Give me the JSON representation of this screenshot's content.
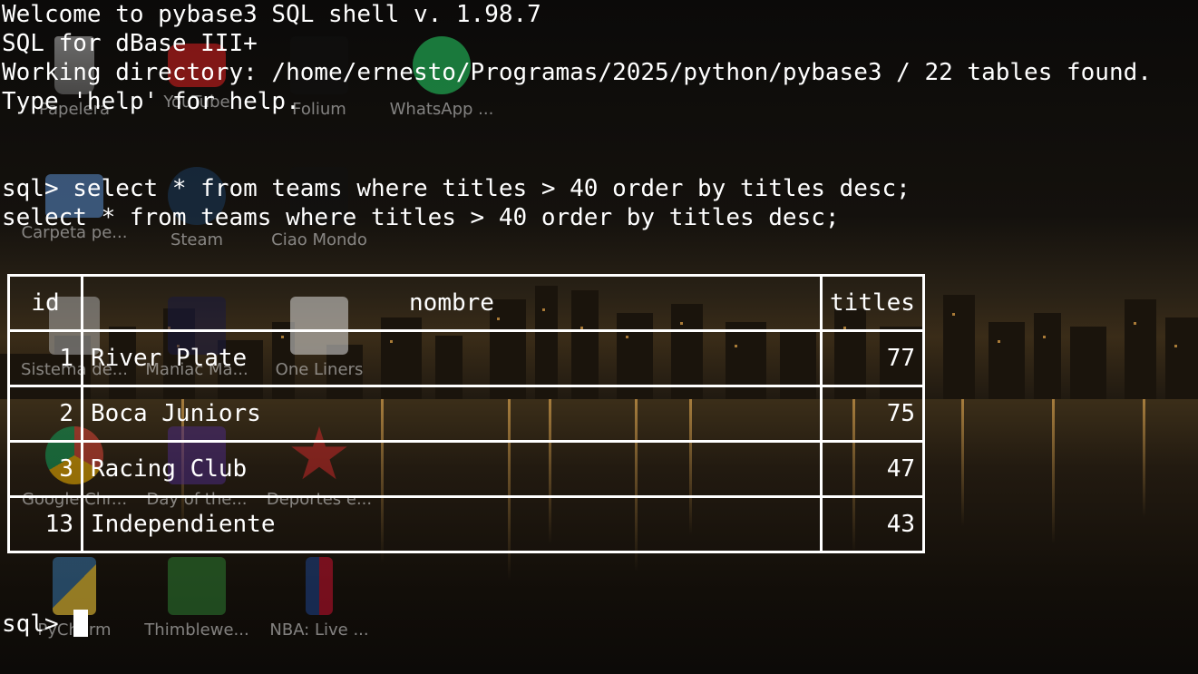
{
  "desktop": {
    "icons": [
      {
        "label": "Papelera",
        "icon": "trash-icon"
      },
      {
        "label": "YouTube",
        "icon": "youtube-icon"
      },
      {
        "label": "Folium",
        "icon": "folium-icon"
      },
      {
        "label": "WhatsApp ...",
        "icon": "whatsapp-icon"
      },
      {
        "label": "Carpeta pe...",
        "icon": "folder-icon"
      },
      {
        "label": "Steam",
        "icon": "steam-icon"
      },
      {
        "label": "Ciao Mondo",
        "icon": "ciao-mondo-icon"
      },
      {
        "label": "Sistema de...",
        "icon": "drive-icon"
      },
      {
        "label": "Maniac Ma...",
        "icon": "maniac-mansion-icon"
      },
      {
        "label": "One Liners",
        "icon": "one-liners-icon"
      },
      {
        "label": "Google Chr...",
        "icon": "chrome-icon"
      },
      {
        "label": "Day of the...",
        "icon": "day-of-tentacle-icon"
      },
      {
        "label": "Deportes e...",
        "icon": "deportes-icon"
      },
      {
        "label": "PyCharm",
        "icon": "python-icon"
      },
      {
        "label": "Thimblewe...",
        "icon": "thimbleweed-park-icon"
      },
      {
        "label": "NBA: Live ...",
        "icon": "nba-icon"
      }
    ]
  },
  "terminal": {
    "welcome": "Welcome to pybase3 SQL shell v. 1.98.7",
    "subtitle": "SQL for dBase III+",
    "workdir": "Working directory: /home/ernesto/Programas/2025/python/pybase3 / 22 tables found.",
    "help": "Type 'help' for help.",
    "command": "sql> select * from teams where titles > 40 order by titles desc;",
    "echo": "select * from teams where titles > 40 order by titles desc;",
    "prompt": "sql>"
  },
  "result": {
    "headers": [
      "id",
      "nombre",
      "titles"
    ],
    "rows": [
      {
        "id": "1",
        "nombre": "River Plate",
        "titles": "77"
      },
      {
        "id": "2",
        "nombre": "Boca Juniors",
        "titles": "75"
      },
      {
        "id": "3",
        "nombre": "Racing Club",
        "titles": "47"
      },
      {
        "id": "13",
        "nombre": "Independiente",
        "titles": "43"
      }
    ]
  },
  "colors": {
    "text": "#ffffff",
    "accent_light": "#ffbe5a"
  }
}
